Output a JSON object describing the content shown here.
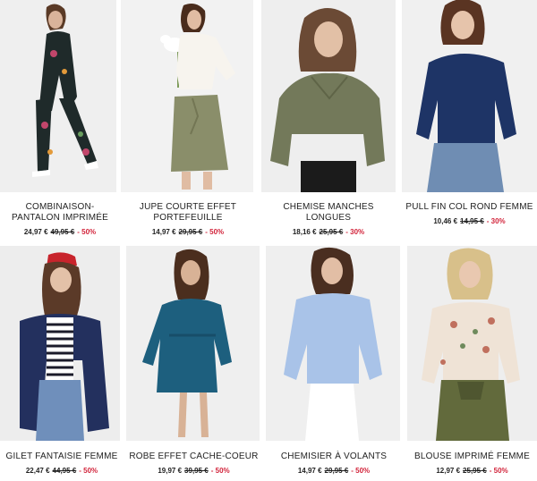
{
  "products": [
    {
      "name": "COMBINAISON-PANTALON IMPRIMÉE",
      "price": "24,97 €",
      "old_price": "49,95 €",
      "discount": "- 50%"
    },
    {
      "name": "JUPE COURTE EFFET PORTEFEUILLE",
      "price": "14,97 €",
      "old_price": "29,95 €",
      "discount": "- 50%"
    },
    {
      "name": "CHEMISE MANCHES LONGUES",
      "price": "18,16 €",
      "old_price": "25,95 €",
      "discount": "- 30%"
    },
    {
      "name": "PULL FIN COL ROND FEMME",
      "price": "10,46 €",
      "old_price": "14,95 €",
      "discount": "- 30%"
    },
    {
      "name": "GILET FANTAISIE FEMME",
      "price": "22,47 €",
      "old_price": "44,95 €",
      "discount": "- 50%"
    },
    {
      "name": "ROBE EFFET CACHE-COEUR",
      "price": "19,97 €",
      "old_price": "39,95 €",
      "discount": "- 50%"
    },
    {
      "name": "CHEMISIER À VOLANTS",
      "price": "14,97 €",
      "old_price": "29,95 €",
      "discount": "- 50%"
    },
    {
      "name": "BLOUSE IMPRIMÉ FEMME",
      "price": "12,97 €",
      "old_price": "25,95 €",
      "discount": "- 50%"
    }
  ]
}
